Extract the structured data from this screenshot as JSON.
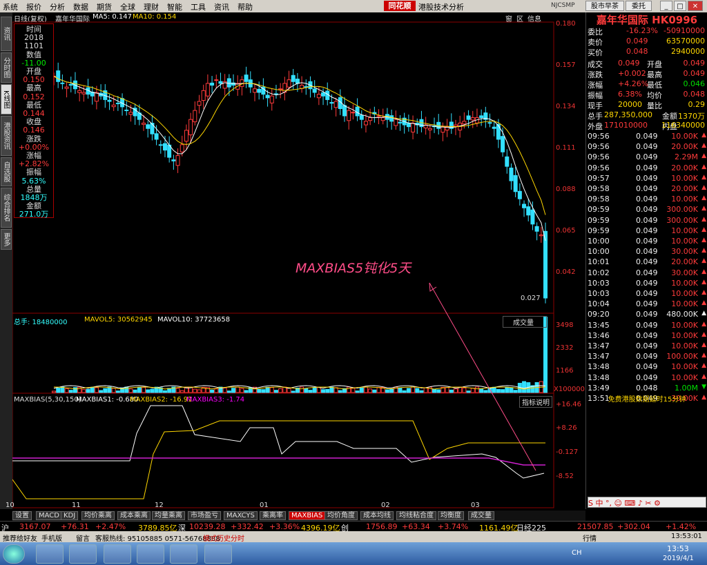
{
  "menu": [
    "系统",
    "报价",
    "分析",
    "数据",
    "期货",
    "全球",
    "理财",
    "智能",
    "工具",
    "资讯",
    "帮助"
  ],
  "brand": "同花顺",
  "subtitle": "港股技术分析",
  "menu_right_code": "NJCSMP",
  "menu_right_btns": [
    "股市早茶",
    "委托"
  ],
  "left_tabs": [
    "资讯",
    "分时图",
    "K线图",
    "港股资讯",
    "自选股",
    "综合排名",
    "更多"
  ],
  "chart_header": {
    "period": "日线(复权)",
    "name": "嘉年华国际",
    "ma5": "MA5: 0.147",
    "ma10": "MA10: 0.154",
    "btns": [
      "窗",
      "区",
      "信息"
    ]
  },
  "price_axis": [
    "0.180",
    "0.157",
    "0.134",
    "0.111",
    "0.088",
    "0.065",
    "0.042"
  ],
  "last_price_tag": "0.027",
  "infobox": {
    "labels": [
      "时间",
      "2018",
      "1101",
      "数值",
      "-11.00",
      "开盘",
      "0.150",
      "最高",
      "0.152",
      "最低",
      "0.144",
      "收盘",
      "0.146",
      "涨跌",
      "+0.00%",
      "涨幅",
      "+2.82%",
      "振幅",
      "5.63%",
      "总量",
      "1848万",
      "金额",
      "271.0万"
    ]
  },
  "vol_header": {
    "total": "总手: 18480000",
    "mavol5": "MAVOL5: 30562945",
    "mavol10": "MAVOL10: 37723658",
    "btn": "成交量"
  },
  "vol_axis": [
    "3498",
    "2332",
    "1166",
    "X100000"
  ],
  "bias_header": {
    "title": "MAXBIAS(5,30,150)",
    "b1": "MAXBIAS1: -0.680",
    "b2": "MAXBIAS2: -16.91",
    "b3": "MAXBIAS3: -1.74",
    "btn": "指标说明"
  },
  "bias_axis": [
    "+16.46",
    "+8.26",
    "-0.127",
    "-8.52"
  ],
  "x_axis": [
    "10",
    "11",
    "12",
    "01",
    "02",
    "03"
  ],
  "annotation": "MAXBIAS5钝化5天",
  "right_panel": {
    "title": "嘉年华国际 HK0996",
    "rows": [
      [
        "委比",
        "-16.23%",
        "-50910000"
      ],
      [
        "卖价",
        "0.049",
        "63570000"
      ],
      [
        "买价",
        "0.048",
        "2940000"
      ]
    ],
    "stats": [
      [
        "成交",
        "0.049",
        "开盘",
        "0.049"
      ],
      [
        "涨跌",
        "+0.002",
        "最高",
        "0.049"
      ],
      [
        "涨幅",
        "+4.26%",
        "最低",
        "0.046"
      ],
      [
        "振幅",
        "6.38%",
        "均价",
        "0.048"
      ],
      [
        "现手",
        "20000",
        "量比",
        "0.29"
      ],
      [
        "总手",
        "287,350,000",
        "金额",
        "1370万"
      ],
      [
        "外盘",
        "171010000",
        "内盘",
        "116340000"
      ]
    ],
    "ticks": [
      [
        "09:56",
        "0.049",
        "10.00K"
      ],
      [
        "09:56",
        "0.049",
        "20.00K"
      ],
      [
        "09:56",
        "0.049",
        "2.29M"
      ],
      [
        "09:56",
        "0.049",
        "20.00K"
      ],
      [
        "09:57",
        "0.049",
        "10.00K"
      ],
      [
        "09:58",
        "0.049",
        "20.00K"
      ],
      [
        "09:58",
        "0.049",
        "10.00K"
      ],
      [
        "09:59",
        "0.049",
        "300.00K"
      ],
      [
        "09:59",
        "0.049",
        "300.00K"
      ],
      [
        "09:59",
        "0.049",
        "10.00K"
      ],
      [
        "10:00",
        "0.049",
        "10.00K"
      ],
      [
        "10:00",
        "0.049",
        "30.00K"
      ],
      [
        "10:01",
        "0.049",
        "20.00K"
      ],
      [
        "10:02",
        "0.049",
        "30.00K"
      ],
      [
        "10:03",
        "0.049",
        "10.00K"
      ],
      [
        "10:03",
        "0.049",
        "10.00K"
      ],
      [
        "10:04",
        "0.049",
        "10.00K"
      ],
      [
        "09:20",
        "0.049",
        "480.00K"
      ],
      [
        "13:45",
        "0.049",
        "10.00K"
      ],
      [
        "13:46",
        "0.049",
        "10.00K"
      ],
      [
        "13:47",
        "0.049",
        "10.00K"
      ],
      [
        "13:47",
        "0.049",
        "100.00K"
      ],
      [
        "13:48",
        "0.049",
        "10.00K"
      ],
      [
        "13:48",
        "0.049",
        "10.00K"
      ],
      [
        "13:49",
        "0.048",
        "1.00M"
      ],
      [
        "13:51",
        "0.049",
        "30.00K"
      ]
    ],
    "footer": "免费港股数据延时15分钟"
  },
  "bottom_tabs": [
    "设置",
    "MACD",
    "KDJ",
    "均价乘离",
    "成本乘离",
    "均量乘离",
    "市场盈亏",
    "MAXCYS",
    "乘离率",
    "MAXBIAS",
    "均价角度",
    "成本均线",
    "均线粘合度",
    "均衡度",
    "成交量"
  ],
  "index_bar": {
    "sh": "沪",
    "sh_val": "3167.07",
    "sh_chg": "+76.31",
    "sh_pct": "+2.47%",
    "sh_amt": "3789.85亿",
    "sz": "深",
    "sz_val": "10239.28",
    "sz_chg": "+332.42",
    "sz_pct": "+3.36%",
    "sz_amt": "4396.19亿",
    "cy": "创",
    "cy_val": "1756.89",
    "cy_chg": "+63.34",
    "cy_pct": "+3.74%",
    "cy_amt": "1161.49亿",
    "nk": "日经225",
    "nk_val": "21507.85",
    "nk_chg": "+302.04",
    "nk_pct": "+1.42%"
  },
  "status_bar": {
    "a": "推荐给好友",
    "b": "手机版",
    "c": "留言",
    "d": "客服热线: 95105885 0571-56768888",
    "e": "模式历史分时",
    "time": "13:53:01",
    "f": "行情"
  },
  "taskbar": {
    "time": "13:53",
    "date": "2019/4/1",
    "ime": "CH"
  },
  "colors": {
    "up": "#ff3b3b",
    "down": "#33e0ff",
    "ma5": "#ffffff",
    "ma10": "#ffd700",
    "bias3": "#d020d0"
  }
}
